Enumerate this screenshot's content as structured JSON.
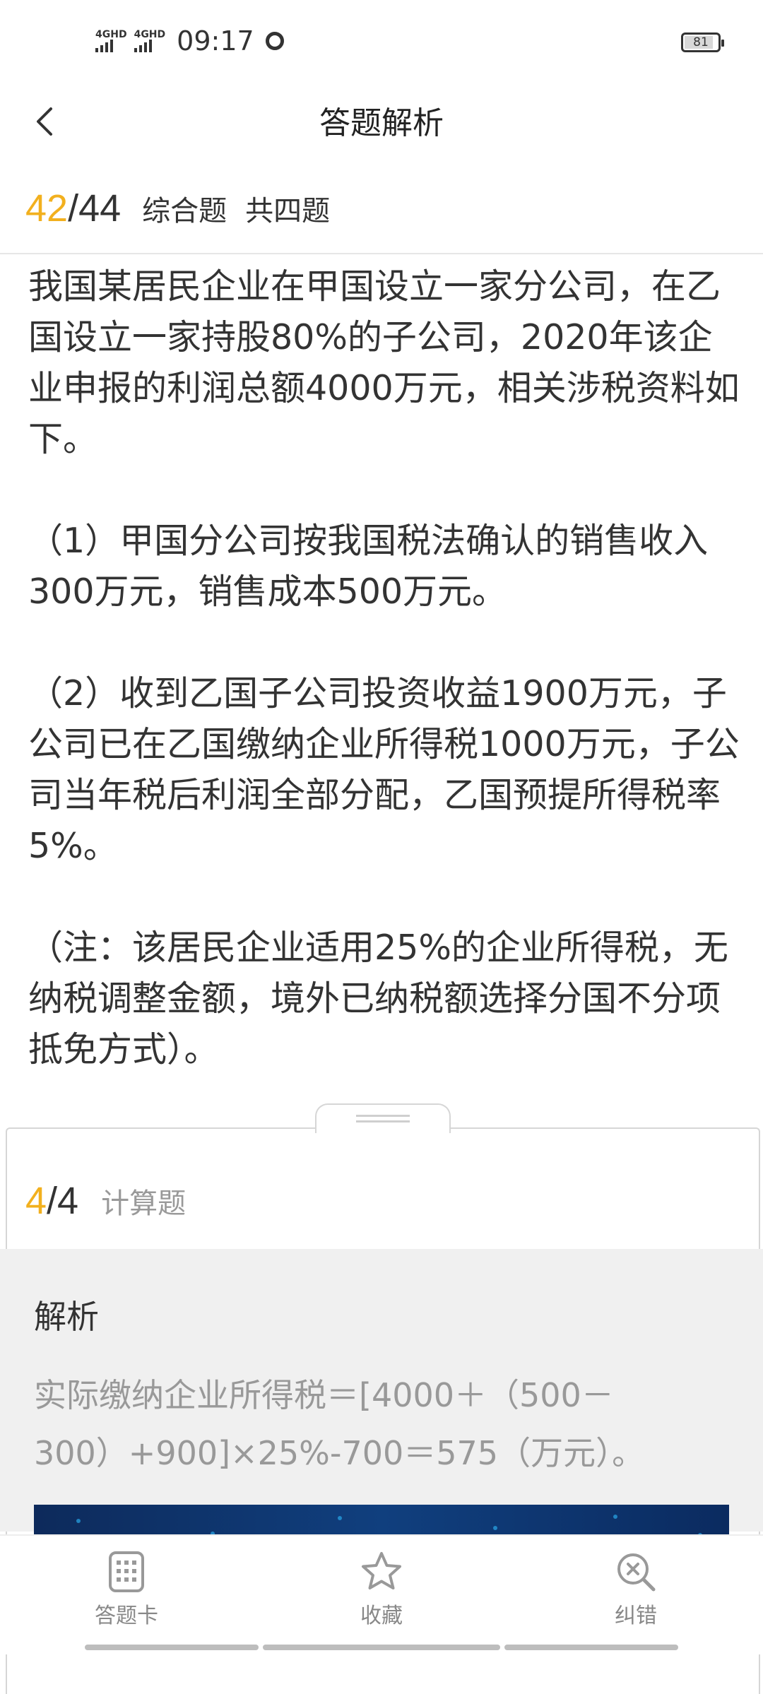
{
  "status_bar": {
    "net1": "4GHD",
    "net2": "4GHD",
    "time": "09:17",
    "battery": "81"
  },
  "nav": {
    "title": "答题解析"
  },
  "question_header": {
    "current": "42",
    "separator": "/",
    "total": "44",
    "type": "综合题",
    "count": "共四题"
  },
  "stem": {
    "paragraphs": [
      "我国某居民企业在甲国设立一家分公司，在乙国设立一家持股80%的子公司，2020年该企业申报的利润总额4000万元，相关涉税资料如下。",
      "（1）甲国分公司按我国税法确认的销售收入300万元，销售成本500万元。",
      "（2）收到乙国子公司投资收益1900万元，子公司已在乙国缴纳企业所得税1000万元，子公司当年税后利润全部分配，乙国预提所得税率5%。",
      "（注：该居民企业适用25%的企业所得税，无纳税调整金额，境外已纳税额选择分国不分项抵免方式）。"
    ]
  },
  "sub_question": {
    "current": "4",
    "rest": "/4",
    "type": "计算题"
  },
  "analysis": {
    "title": "解析",
    "text": "实际缴纳企业所得税＝[4000＋（500－300）+900]×25%-700＝575（万元）。"
  },
  "tabbar": {
    "items": [
      {
        "label": "答题卡",
        "icon": "answer-card-icon"
      },
      {
        "label": "收藏",
        "icon": "star-icon"
      },
      {
        "label": "纠错",
        "icon": "error-correct-icon"
      }
    ]
  }
}
